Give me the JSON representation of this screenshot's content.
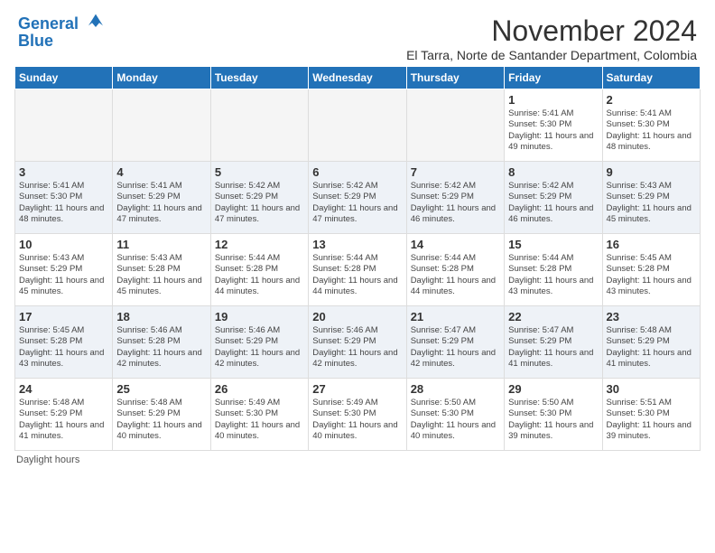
{
  "header": {
    "logo_line1": "General",
    "logo_line2": "Blue",
    "month_title": "November 2024",
    "subtitle": "El Tarra, Norte de Santander Department, Colombia"
  },
  "footer": {
    "note": "Daylight hours"
  },
  "days_of_week": [
    "Sunday",
    "Monday",
    "Tuesday",
    "Wednesday",
    "Thursday",
    "Friday",
    "Saturday"
  ],
  "weeks": [
    {
      "days": [
        {
          "num": "",
          "info": ""
        },
        {
          "num": "",
          "info": ""
        },
        {
          "num": "",
          "info": ""
        },
        {
          "num": "",
          "info": ""
        },
        {
          "num": "",
          "info": ""
        },
        {
          "num": "1",
          "info": "Sunrise: 5:41 AM\nSunset: 5:30 PM\nDaylight: 11 hours and 49 minutes."
        },
        {
          "num": "2",
          "info": "Sunrise: 5:41 AM\nSunset: 5:30 PM\nDaylight: 11 hours and 48 minutes."
        }
      ]
    },
    {
      "days": [
        {
          "num": "3",
          "info": "Sunrise: 5:41 AM\nSunset: 5:30 PM\nDaylight: 11 hours and 48 minutes."
        },
        {
          "num": "4",
          "info": "Sunrise: 5:41 AM\nSunset: 5:29 PM\nDaylight: 11 hours and 47 minutes."
        },
        {
          "num": "5",
          "info": "Sunrise: 5:42 AM\nSunset: 5:29 PM\nDaylight: 11 hours and 47 minutes."
        },
        {
          "num": "6",
          "info": "Sunrise: 5:42 AM\nSunset: 5:29 PM\nDaylight: 11 hours and 47 minutes."
        },
        {
          "num": "7",
          "info": "Sunrise: 5:42 AM\nSunset: 5:29 PM\nDaylight: 11 hours and 46 minutes."
        },
        {
          "num": "8",
          "info": "Sunrise: 5:42 AM\nSunset: 5:29 PM\nDaylight: 11 hours and 46 minutes."
        },
        {
          "num": "9",
          "info": "Sunrise: 5:43 AM\nSunset: 5:29 PM\nDaylight: 11 hours and 45 minutes."
        }
      ]
    },
    {
      "days": [
        {
          "num": "10",
          "info": "Sunrise: 5:43 AM\nSunset: 5:29 PM\nDaylight: 11 hours and 45 minutes."
        },
        {
          "num": "11",
          "info": "Sunrise: 5:43 AM\nSunset: 5:28 PM\nDaylight: 11 hours and 45 minutes."
        },
        {
          "num": "12",
          "info": "Sunrise: 5:44 AM\nSunset: 5:28 PM\nDaylight: 11 hours and 44 minutes."
        },
        {
          "num": "13",
          "info": "Sunrise: 5:44 AM\nSunset: 5:28 PM\nDaylight: 11 hours and 44 minutes."
        },
        {
          "num": "14",
          "info": "Sunrise: 5:44 AM\nSunset: 5:28 PM\nDaylight: 11 hours and 44 minutes."
        },
        {
          "num": "15",
          "info": "Sunrise: 5:44 AM\nSunset: 5:28 PM\nDaylight: 11 hours and 43 minutes."
        },
        {
          "num": "16",
          "info": "Sunrise: 5:45 AM\nSunset: 5:28 PM\nDaylight: 11 hours and 43 minutes."
        }
      ]
    },
    {
      "days": [
        {
          "num": "17",
          "info": "Sunrise: 5:45 AM\nSunset: 5:28 PM\nDaylight: 11 hours and 43 minutes."
        },
        {
          "num": "18",
          "info": "Sunrise: 5:46 AM\nSunset: 5:28 PM\nDaylight: 11 hours and 42 minutes."
        },
        {
          "num": "19",
          "info": "Sunrise: 5:46 AM\nSunset: 5:29 PM\nDaylight: 11 hours and 42 minutes."
        },
        {
          "num": "20",
          "info": "Sunrise: 5:46 AM\nSunset: 5:29 PM\nDaylight: 11 hours and 42 minutes."
        },
        {
          "num": "21",
          "info": "Sunrise: 5:47 AM\nSunset: 5:29 PM\nDaylight: 11 hours and 42 minutes."
        },
        {
          "num": "22",
          "info": "Sunrise: 5:47 AM\nSunset: 5:29 PM\nDaylight: 11 hours and 41 minutes."
        },
        {
          "num": "23",
          "info": "Sunrise: 5:48 AM\nSunset: 5:29 PM\nDaylight: 11 hours and 41 minutes."
        }
      ]
    },
    {
      "days": [
        {
          "num": "24",
          "info": "Sunrise: 5:48 AM\nSunset: 5:29 PM\nDaylight: 11 hours and 41 minutes."
        },
        {
          "num": "25",
          "info": "Sunrise: 5:48 AM\nSunset: 5:29 PM\nDaylight: 11 hours and 40 minutes."
        },
        {
          "num": "26",
          "info": "Sunrise: 5:49 AM\nSunset: 5:30 PM\nDaylight: 11 hours and 40 minutes."
        },
        {
          "num": "27",
          "info": "Sunrise: 5:49 AM\nSunset: 5:30 PM\nDaylight: 11 hours and 40 minutes."
        },
        {
          "num": "28",
          "info": "Sunrise: 5:50 AM\nSunset: 5:30 PM\nDaylight: 11 hours and 40 minutes."
        },
        {
          "num": "29",
          "info": "Sunrise: 5:50 AM\nSunset: 5:30 PM\nDaylight: 11 hours and 39 minutes."
        },
        {
          "num": "30",
          "info": "Sunrise: 5:51 AM\nSunset: 5:30 PM\nDaylight: 11 hours and 39 minutes."
        }
      ]
    }
  ]
}
